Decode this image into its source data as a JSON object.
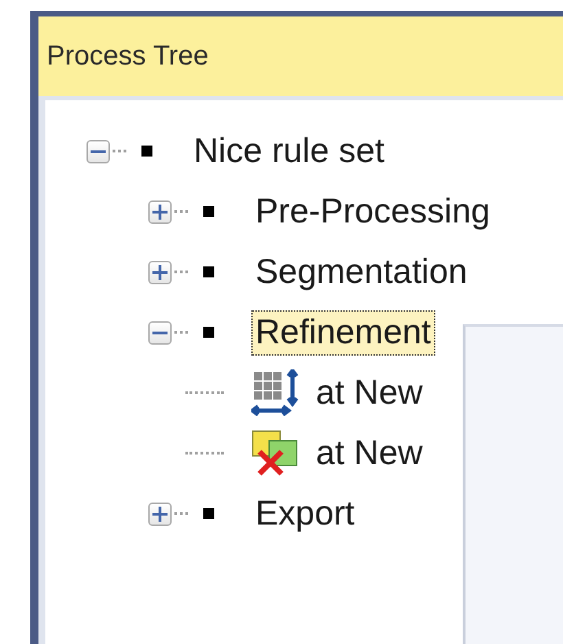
{
  "panel": {
    "title": "Process Tree"
  },
  "tree": [
    {
      "label": "Nice rule set",
      "kind": "process",
      "expanded": true,
      "selected": false,
      "children": [
        {
          "label": "Pre-Processing",
          "kind": "process",
          "expanded": false,
          "selected": false
        },
        {
          "label": "Segmentation",
          "kind": "process",
          "expanded": false,
          "selected": false
        },
        {
          "label": "Refinement",
          "kind": "process",
          "expanded": true,
          "selected": true,
          "children": [
            {
              "label": "at  New",
              "kind": "grid",
              "selected": false
            },
            {
              "label": "at  New",
              "kind": "merge",
              "selected": false
            }
          ]
        },
        {
          "label": "Export",
          "kind": "process",
          "expanded": false,
          "selected": false
        }
      ]
    }
  ]
}
